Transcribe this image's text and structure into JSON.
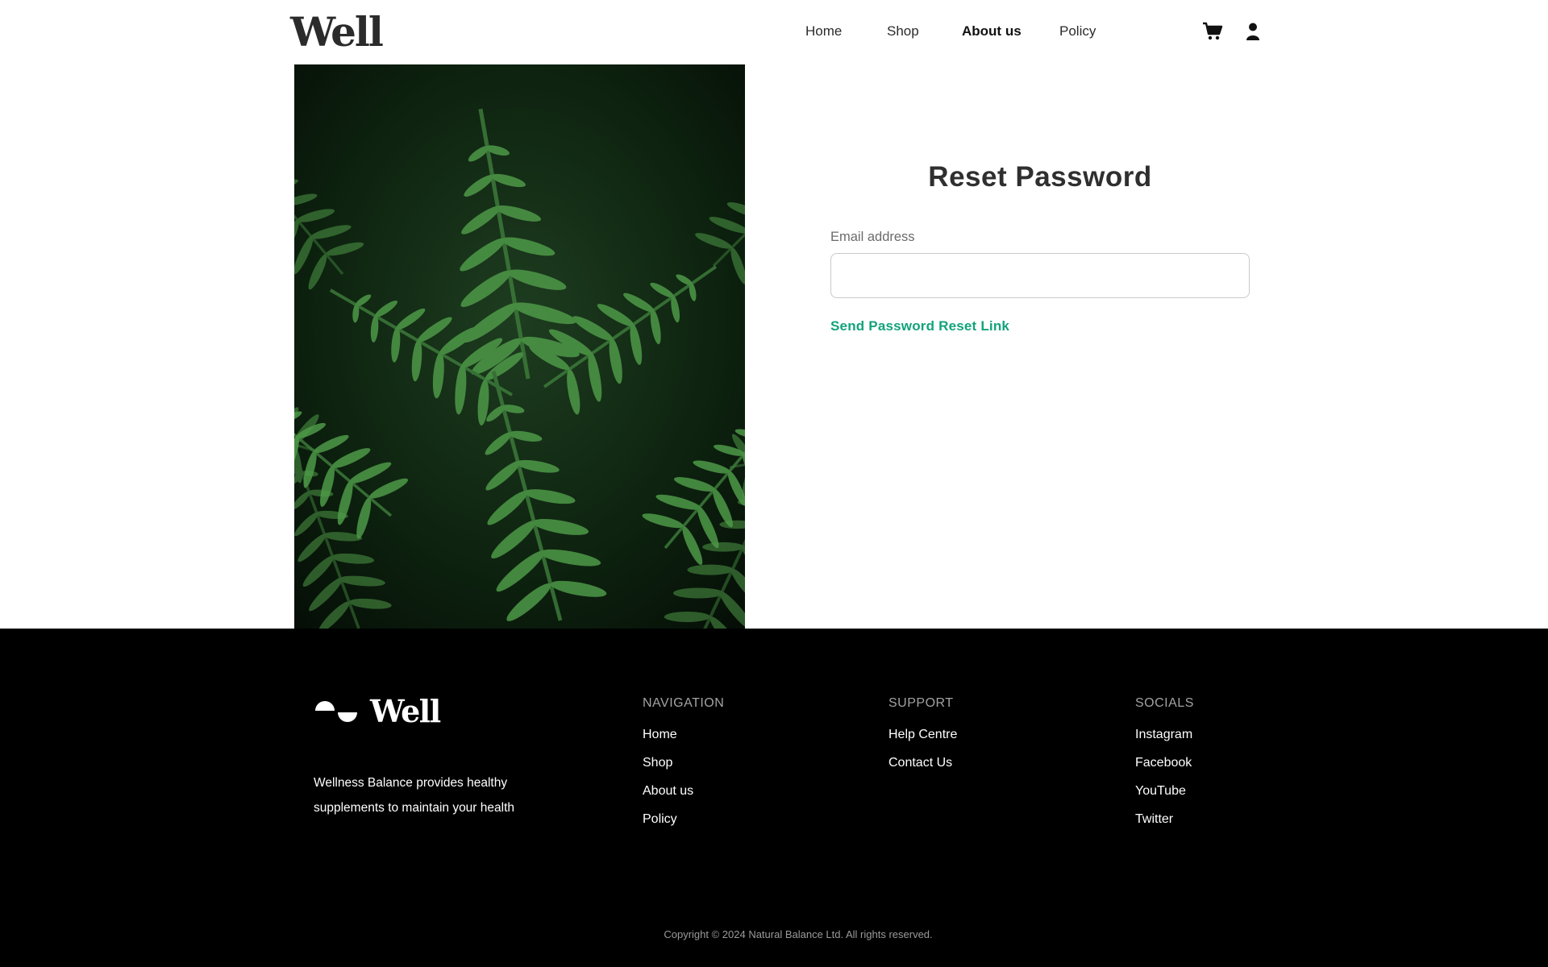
{
  "header": {
    "logo": "Well",
    "nav": [
      "Home",
      "Shop",
      "About us",
      "Policy"
    ],
    "active_nav": "About us",
    "icons": {
      "cart": "cart-icon",
      "user": "user-icon"
    }
  },
  "main": {
    "image": "fern-leaves-photo",
    "title": "Reset Password",
    "email_label": "Email address",
    "email_value": "",
    "email_placeholder": "",
    "submit_label": "Send Password Reset Link",
    "accent_color": "#12a37b"
  },
  "footer": {
    "logo": "Well",
    "description": "Wellness Balance provides healthy supplements to maintain your health",
    "columns": [
      {
        "heading": "NAVIGATION",
        "links": [
          "Home",
          "Shop",
          "About us",
          "Policy"
        ]
      },
      {
        "heading": "SUPPORT",
        "links": [
          "Help Centre",
          "Contact Us"
        ]
      },
      {
        "heading": "SOCIALS",
        "links": [
          "Instagram",
          "Facebook",
          "YouTube",
          "Twitter"
        ]
      }
    ],
    "copyright": "Copyright © 2024 Natural Balance Ltd. All rights reserved."
  }
}
